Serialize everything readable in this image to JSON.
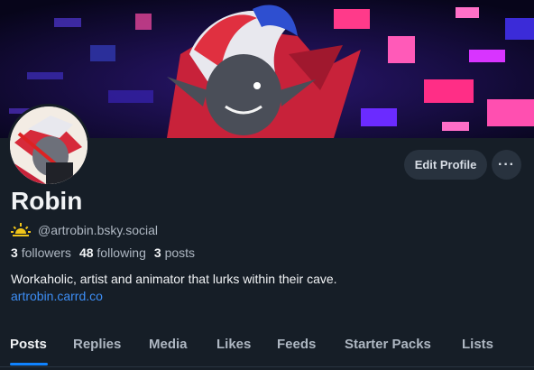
{
  "profile": {
    "display_name": "Robin",
    "handle": "@artrobin.bsky.social",
    "handle_badge_icon": "sunrise-icon",
    "stats": {
      "followers_count": "3",
      "followers_label": "followers",
      "following_count": "48",
      "following_label": "following",
      "posts_count": "3",
      "posts_label": "posts"
    },
    "bio": "Workaholic, artist and animator that lurks within their cave.",
    "link": "artrobin.carrd.co"
  },
  "actions": {
    "edit_profile_label": "Edit Profile",
    "more_label": "···"
  },
  "tabs": [
    {
      "label": "Posts",
      "active": true
    },
    {
      "label": "Replies",
      "active": false
    },
    {
      "label": "Media",
      "active": false
    },
    {
      "label": "Likes",
      "active": false
    },
    {
      "label": "Feeds",
      "active": false
    },
    {
      "label": "Starter Packs",
      "active": false
    },
    {
      "label": "Lists",
      "active": false
    }
  ],
  "colors": {
    "background": "#161e27",
    "accent": "#1083fe",
    "link": "#3d8ef5",
    "button_bg": "#28323e",
    "badge": "#f0c419"
  }
}
